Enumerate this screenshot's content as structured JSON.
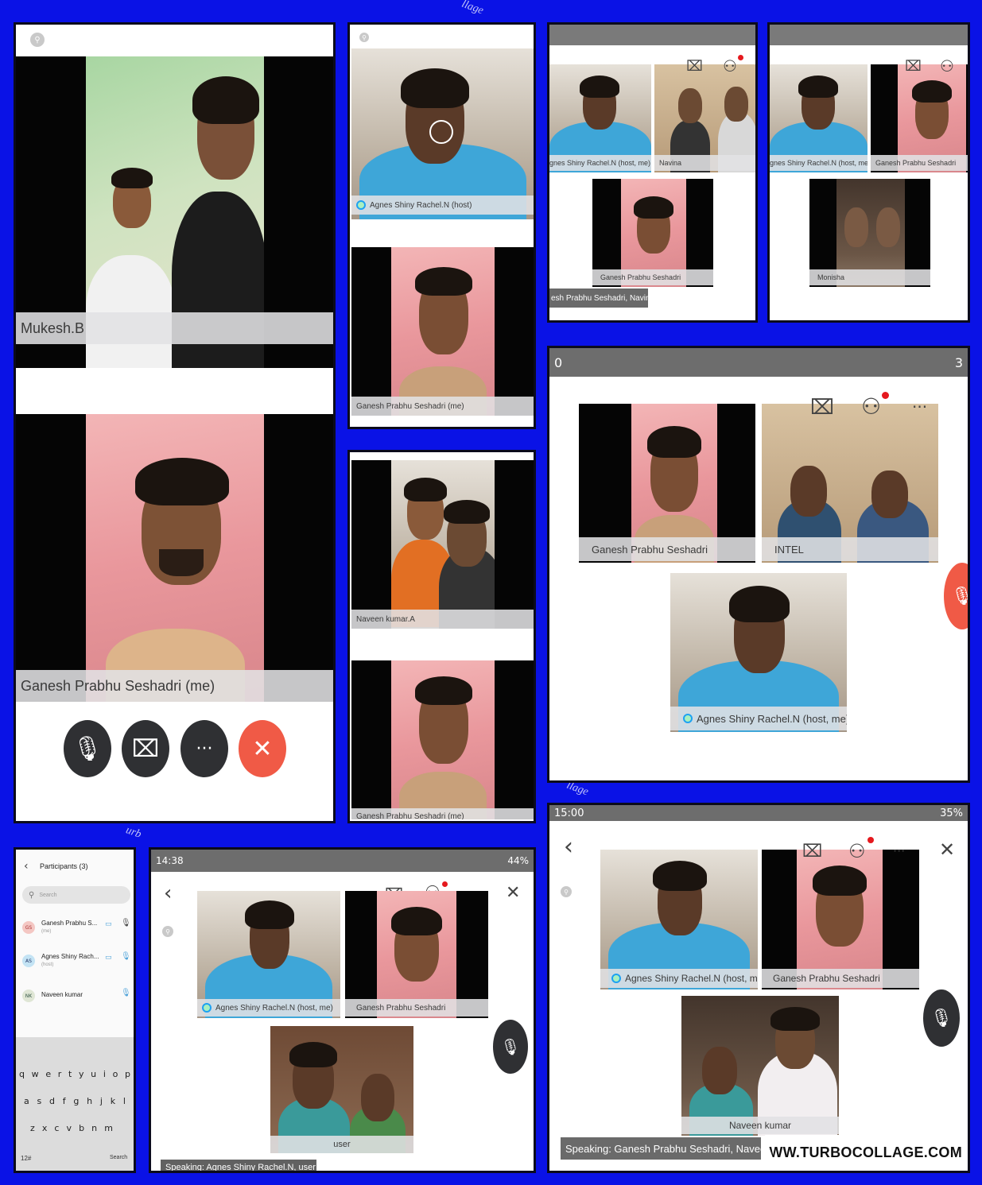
{
  "panel1": {
    "top_name": "Mukesh.B",
    "bottom_name": "Ganesh Prabhu Seshadri (me)",
    "controls": {
      "mute": "🎙",
      "video": "⌧",
      "more": "···",
      "leave": "✕"
    }
  },
  "panel2": {
    "top_name": "Agnes Shiny Rachel.N (host)",
    "bottom_name": "Ganesh Prabhu Seshadri (me)"
  },
  "panel3": {
    "tile1": "gnes Shiny Rachel.N (host, me)",
    "tile2": "Navina",
    "tile3": "Ganesh Prabhu Seshadri",
    "speaking": "esh Prabhu Seshadri, Navina"
  },
  "panel4": {
    "tile1": "gnes Shiny Rachel.N (host, me)",
    "tile2": "Ganesh Prabhu Seshadri",
    "tile3": "Monisha"
  },
  "panel5": {
    "status_left": "0",
    "status_right": "3",
    "tile1": "Ganesh Prabhu Seshadri",
    "tile2": "INTEL",
    "tile3": "Agnes Shiny Rachel.N (host, me)"
  },
  "panel6": {
    "top_name": "Naveen kumar.A",
    "bottom_name": "Ganesh Prabhu Seshadri (me)"
  },
  "panel7": {
    "title": "Participants (3)",
    "search_placeholder": "Search",
    "participants": [
      {
        "name": "Ganesh Prabhu S...",
        "sub": "(me)",
        "initials": "GS"
      },
      {
        "name": "Agnes Shiny Rach...",
        "sub": "(host)",
        "initials": "AS"
      },
      {
        "name": "Naveen kumar",
        "sub": "",
        "initials": "NK"
      }
    ],
    "keyboard_row1": [
      "q",
      "w",
      "e",
      "r",
      "t",
      "y",
      "u",
      "i",
      "o",
      "p"
    ],
    "keyboard_row2": [
      "a",
      "s",
      "d",
      "f",
      "g",
      "h",
      "j",
      "k",
      "l"
    ],
    "keyboard_row3": [
      "z",
      "x",
      "c",
      "v",
      "b",
      "n",
      "m"
    ],
    "key_symbols": "12#",
    "key_search": "Search"
  },
  "panel8": {
    "status_time": "14:38",
    "status_battery": "44%",
    "tile1": "Agnes Shiny Rachel.N (host, me)",
    "tile2": "Ganesh Prabhu Seshadri",
    "tile3": "user",
    "speaking": "Speaking: Agnes Shiny Rachel.N, user"
  },
  "panel9": {
    "status_time": "15:00",
    "status_battery": "35%",
    "tile1": "Agnes Shiny Rachel.N (host, me)",
    "tile2": "Ganesh Prabhu Seshadri",
    "tile3": "Naveen kumar",
    "speaking": "Speaking: Ganesh Prabhu Seshadri, Naveen..."
  },
  "watermark": "WWW.TURBOCOLLAGE.COM",
  "colors": {
    "background": "#0a12e6",
    "leave_red": "#f05a46",
    "control_dark": "#2f3033"
  }
}
